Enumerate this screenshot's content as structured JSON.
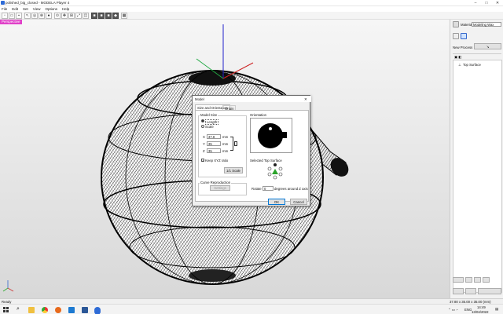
{
  "window": {
    "title": "polished_big_closed - MODELA Player 4",
    "minimize": "–",
    "maximize": "□",
    "close": "✕"
  },
  "menu": [
    "File",
    "Edit",
    "Set",
    "View",
    "Options",
    "Help"
  ],
  "toolbar_icons": [
    "new-icon",
    "open-icon",
    "save-icon",
    "select-icon",
    "orbit-icon",
    "zoom-icon",
    "shade-icon",
    "view-icon",
    "move-icon",
    "zoom-box-icon",
    "zoom-fit-icon",
    "front-view-icon",
    "back-view-icon",
    "side-view-icon",
    "top-view-icon",
    "iso-view-icon",
    "wireframe-icon"
  ],
  "viewport": {
    "projection_label": "Perspective"
  },
  "dialog": {
    "title": "Model",
    "tabs": [
      "Size and Orientation",
      "Origin"
    ],
    "model_size_label": "Model Size",
    "length_option": "Length",
    "scale_option": "Scale",
    "x_label": "X",
    "y_label": "Y",
    "z_label": "Z",
    "x_value": "37.8",
    "y_value": "35",
    "z_value": "35",
    "unit": "mm",
    "keep_xyz_label": "Keep XYZ ratio",
    "keep_xyz_checked": true,
    "one_to_one_label": "1/1 Scale",
    "curve_label": "Curve Reproduction",
    "curve_btn": "Settings",
    "orientation_label": "Orientation",
    "selected_top_label": "Selected Top Surface",
    "rotate_label": "Rotate",
    "rotate_value": "0",
    "rotate_suffix": "degrees around Z axis",
    "ok": "OK",
    "cancel": "Cancel",
    "close": "✕"
  },
  "right_panel": {
    "material_label": "Material",
    "material_value": "Modeling Wax",
    "new_process_label": "New Process",
    "tree_item": "Top Surface"
  },
  "status": {
    "left": "Ready",
    "coords": "37.80 x 35.00 x 35.00 (mm)"
  },
  "taskbar": {
    "time": "14:49",
    "date": "13/04/2022",
    "lang": "ENG"
  }
}
